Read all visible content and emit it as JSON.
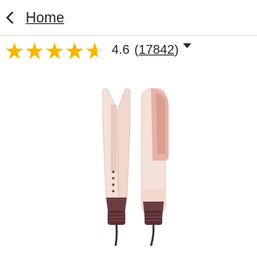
{
  "nav": {
    "back_label": "Home",
    "back_icon": "chevron-left-icon"
  },
  "rating": {
    "stars_filled": 4.6,
    "stars_total": 5,
    "score": "4.6",
    "count_open": "(",
    "count": "17842",
    "count_close": ")",
    "star_color": "#f5b800"
  },
  "product": {
    "body_color": "#f3dcd2",
    "accent_color": "#e7b1a4",
    "base_color": "#5a2f34",
    "cord_color": "#333333"
  }
}
